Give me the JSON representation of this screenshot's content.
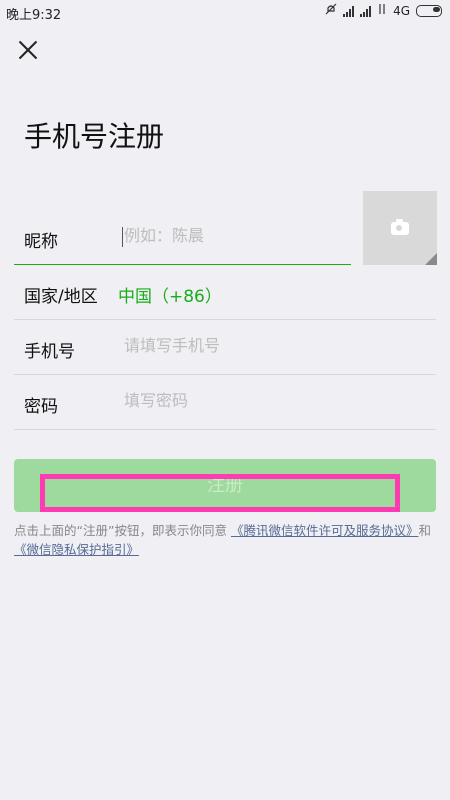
{
  "status_bar": {
    "time": "晚上9:32",
    "network": "4G"
  },
  "header": {
    "close_icon": "close-x",
    "title": "手机号注册"
  },
  "form": {
    "nickname": {
      "label": "昵称",
      "placeholder": "例如：陈晨"
    },
    "country": {
      "label": "国家/地区",
      "value": "中国（+86）"
    },
    "phone": {
      "label": "手机号",
      "placeholder": "请填写手机号"
    },
    "password": {
      "label": "密码",
      "placeholder": "填写密码"
    }
  },
  "avatar": {
    "icon": "camera-icon"
  },
  "register_button": {
    "label": "注册"
  },
  "agreement": {
    "prefix": "点击上面的“注册”按钮，即表示你同意",
    "link1": "《腾讯微信软件许可及服务协议》",
    "and": "和",
    "link2": "《微信隐私保护指引》"
  },
  "colors": {
    "accent": "#1aad19",
    "button_disabled": "#9ed99d",
    "highlight": "#ff3ab3",
    "link": "#576b95"
  }
}
